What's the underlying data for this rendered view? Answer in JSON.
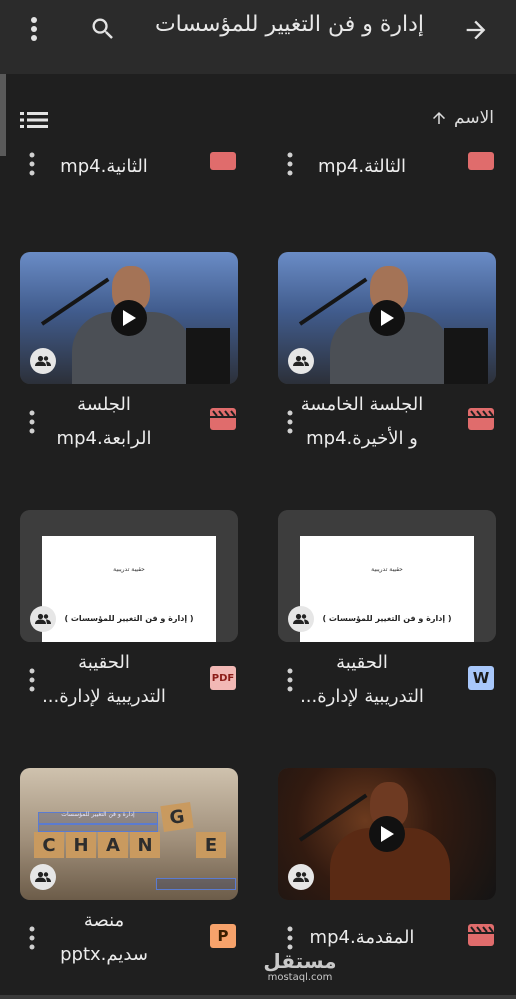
{
  "header": {
    "title": "إدارة و فن التغيير للمؤسسات",
    "back_icon": "arrow-forward-icon",
    "search_icon": "search-icon",
    "more_icon": "more-vert-icon"
  },
  "toolbar": {
    "sort_label": "الاسم",
    "sort_icon": "arrow-up-icon",
    "view_icon": "list-view-icon"
  },
  "files": [
    {
      "line1": "الثالثة.mp4",
      "line2": "",
      "type": "video"
    },
    {
      "line1": "الثانية.mp4",
      "line2": "",
      "type": "video"
    },
    {
      "line1": "الجلسة الخامسة",
      "line2": "و الأخيرة.mp4",
      "type": "video"
    },
    {
      "line1": "الجلسة",
      "line2": "الرابعة.mp4",
      "type": "video"
    },
    {
      "line1": "الحقيبة",
      "line2": "التدريبية لإدارة...",
      "type": "word",
      "doc_small": "حقيبة تدريبية",
      "doc_big": "( إدارة و فن التغيير للمؤسسات )"
    },
    {
      "line1": "الحقيبة",
      "line2": "التدريبية لإدارة...",
      "type": "pdf",
      "doc_small": "حقيبة تدريبية",
      "doc_big": "( إدارة و فن التغيير للمؤسسات )"
    },
    {
      "line1": "المقدمة.mp4",
      "line2": "",
      "type": "video"
    },
    {
      "line1": "منصة",
      "line2": "سديم.pptx",
      "type": "pptx"
    }
  ],
  "file_type_labels": {
    "pdf": "PDF",
    "word": "W",
    "pptx": "P"
  },
  "thumb_text": {
    "change_letters": [
      "C",
      "H",
      "A",
      "N",
      "G",
      "E"
    ],
    "change_caption": "إدارة و فن التغيير للمؤسسات"
  },
  "watermark": {
    "arabic": "مستقل",
    "latin": "mostaql.com"
  },
  "colors": {
    "background": "#1f1f1f",
    "video_icon": "#e06c6c",
    "pdf_icon": "#f2b8b5",
    "word_icon": "#a8c7fa",
    "pptx_icon": "#f6a26b"
  }
}
